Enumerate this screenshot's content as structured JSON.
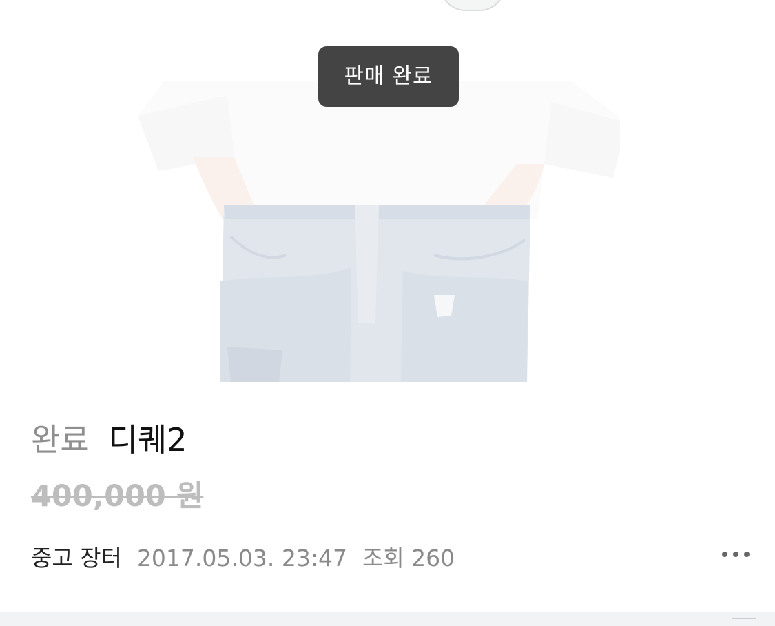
{
  "photo": {
    "subject": "jeans"
  },
  "badge": {
    "label": "판매 완료"
  },
  "post": {
    "status": "완료",
    "title": "디퀘2",
    "price": "400,000 원",
    "board": "중고 장터",
    "date": "2017.05.03. 23:47",
    "views": "조회 260"
  },
  "icons": {
    "more": "more-dots-icon"
  },
  "colors": {
    "badge_bg": "#444444",
    "status_gray": "#8f8f8f",
    "price_gray": "#bdbdbd",
    "meta_gray": "#8a8a8a",
    "title": "#111111"
  }
}
